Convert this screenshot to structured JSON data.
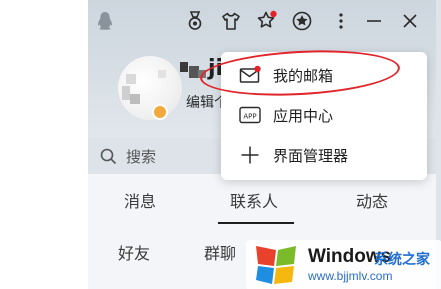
{
  "window": {
    "nickname_fragment": "jic",
    "edit_profile_fragment": "编辑个",
    "search_placeholder": "搜索"
  },
  "titlebar": {
    "icons": [
      "qq-penguin-icon",
      "medal-icon",
      "skin-shirt-icon",
      "star-apps-icon",
      "qzone-icon",
      "more-menu-icon",
      "minimize-icon",
      "close-icon"
    ]
  },
  "tabs": [
    {
      "label": "消息"
    },
    {
      "label": "联系人",
      "selected": true
    },
    {
      "label": "动态"
    }
  ],
  "subtabs": [
    {
      "label": "好友"
    },
    {
      "label": "群聊"
    }
  ],
  "menu": {
    "items": [
      {
        "label": "我的邮箱",
        "icon": "mail-icon",
        "highlighted": true
      },
      {
        "label": "应用中心",
        "icon": "app-icon",
        "icon_text": "APP"
      },
      {
        "label": "界面管理器",
        "icon": "plus-icon"
      }
    ]
  },
  "watermark": {
    "title": "Windows",
    "subtitle": "系统之家",
    "url": "www.bjjmlv.com"
  },
  "colors": {
    "highlight_oval": "#e0242a",
    "notification_dot": "#e0242a",
    "status_badge": "#f2a93b",
    "watermark_url": "#2a6ec8"
  }
}
